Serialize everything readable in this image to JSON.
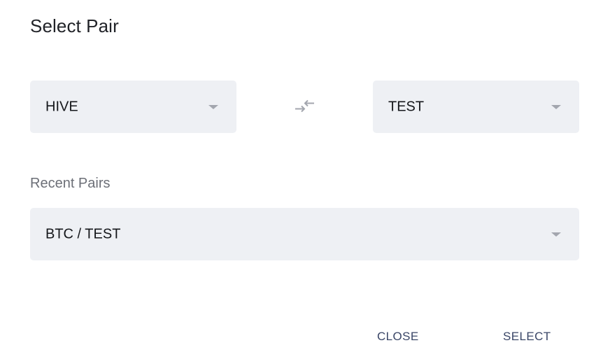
{
  "dialog": {
    "title": "Select Pair",
    "base_asset": {
      "value": "HIVE"
    },
    "quote_asset": {
      "value": "TEST"
    },
    "recent": {
      "label": "Recent Pairs",
      "selected": "BTC / TEST"
    },
    "buttons": {
      "close_label": "CLOSE",
      "select_label": "SELECT"
    }
  },
  "colors": {
    "field_bg": "#eef0f4",
    "button_text": "#3a4667",
    "caret": "#a3a6ae",
    "swap_icon": "#a3a6ae"
  },
  "icons": {
    "swap": "swap-arrows-icon",
    "dropdown": "caret-down-icon"
  }
}
